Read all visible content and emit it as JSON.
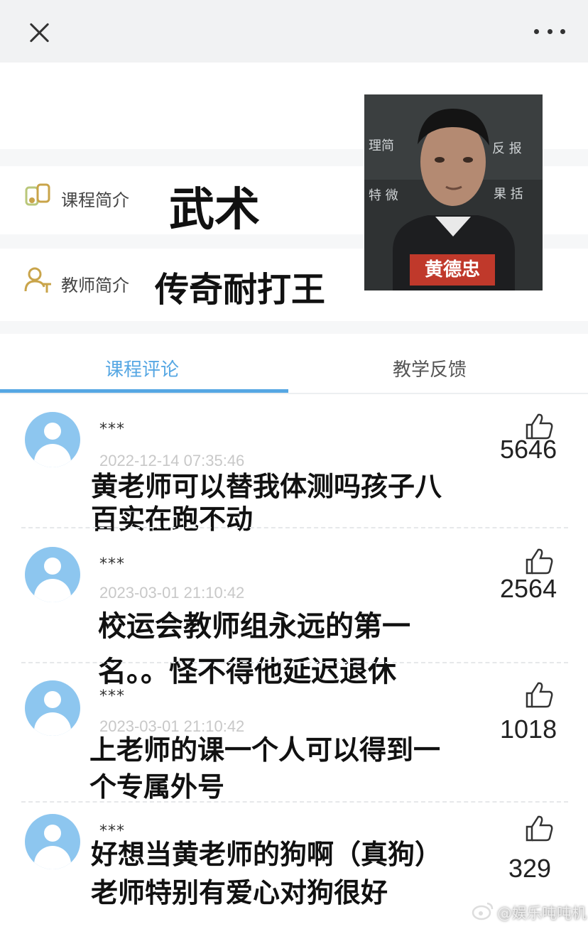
{
  "topbar": {
    "close_icon": "close-icon",
    "more_icon": "more-icon"
  },
  "course": {
    "intro_label": "课程简介",
    "intro_value": "武术",
    "teacher_label": "教师简介",
    "teacher_value": "传奇耐打王",
    "photo_caption": "黄德忠",
    "board_text_1": "理简",
    "board_text_2": "反 报",
    "board_text_3": "特 微",
    "board_text_4": "果 括"
  },
  "tabs": [
    {
      "label": "课程评论",
      "active": true
    },
    {
      "label": "教学反馈",
      "active": false
    }
  ],
  "comments": [
    {
      "user": "***",
      "date": "2022-12-14 07:35:46",
      "likes": "5646",
      "lines": [
        "黄老师可以替我体测吗孩子八",
        "百实在跑不动"
      ]
    },
    {
      "user": "***",
      "date": "2023-03-01 21:10:42",
      "likes": "2564",
      "lines": [
        "校运会教师组永远的第一",
        "名。。怪不得他延迟退休"
      ]
    },
    {
      "user": "***",
      "date": "2023-03-01 21:10:42",
      "likes": "1018",
      "lines": [
        "上老师的课一个人可以得到一",
        "个专属外号"
      ]
    },
    {
      "user": "***",
      "date": "",
      "likes": "329",
      "lines": [
        "好想当黄老师的狗啊（真狗）",
        "老师特别有爱心对狗很好"
      ]
    }
  ],
  "watermark": "@娱乐吨吨机",
  "colors": {
    "accent": "#56a7e3",
    "avatar": "#8dc6ef",
    "icon_gold": "#c9a44a"
  }
}
